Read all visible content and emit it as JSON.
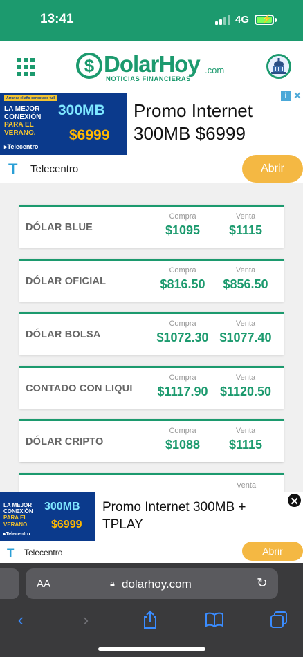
{
  "status_bar": {
    "time": "13:41",
    "network": "4G"
  },
  "header": {
    "logo_text": "DolarHoy",
    "logo_suffix": ".com",
    "logo_subtitle": "NOTICIAS FINANCIERAS",
    "brand_color": "#1c9a6e",
    "menu_icon": "grid-menu-icon",
    "gov_icon": "congress-building-icon"
  },
  "ad_top": {
    "image_tag": "Arranca el año conectado full",
    "image_lines": [
      "LA MEJOR",
      "CONEXIÓN",
      "PARA EL",
      "VERANO."
    ],
    "image_speed": "300MB",
    "image_price": "$6999",
    "image_brand": "Telecentro",
    "title": "Promo Internet 300MB $6999",
    "advertiser": "Telecentro",
    "cta": "Abrir"
  },
  "rates": {
    "buy_label": "Compra",
    "sell_label": "Venta",
    "items": [
      {
        "name": "DÓLAR BLUE",
        "buy": "$1095",
        "sell": "$1115"
      },
      {
        "name": "DÓLAR OFICIAL",
        "buy": "$816.50",
        "sell": "$856.50"
      },
      {
        "name": "DÓLAR BOLSA",
        "buy": "$1072.30",
        "sell": "$1077.40"
      },
      {
        "name": "CONTADO CON LIQUI",
        "buy": "$1117.90",
        "sell": "$1120.50"
      },
      {
        "name": "DÓLAR CRIPTO",
        "buy": "$1088",
        "sell": "$1115"
      }
    ],
    "partial_sell_label": "Venta"
  },
  "ad_bottom": {
    "image_lines": [
      "LA MEJOR",
      "CONEXIÓN",
      "PARA EL",
      "VERANO."
    ],
    "image_speed": "300MB",
    "image_price": "$6999",
    "image_brand": "Telecentro",
    "title": "Promo Internet 300MB + TPLAY",
    "advertiser": "Telecentro",
    "cta": "Abrir"
  },
  "browser": {
    "text_size": "AA",
    "url": "dolarhoy.com"
  },
  "colors": {
    "accent": "#1c9a6e",
    "cta": "#f4b843",
    "safari_bg": "#3a3a3c",
    "safari_blue": "#3a8cff"
  }
}
